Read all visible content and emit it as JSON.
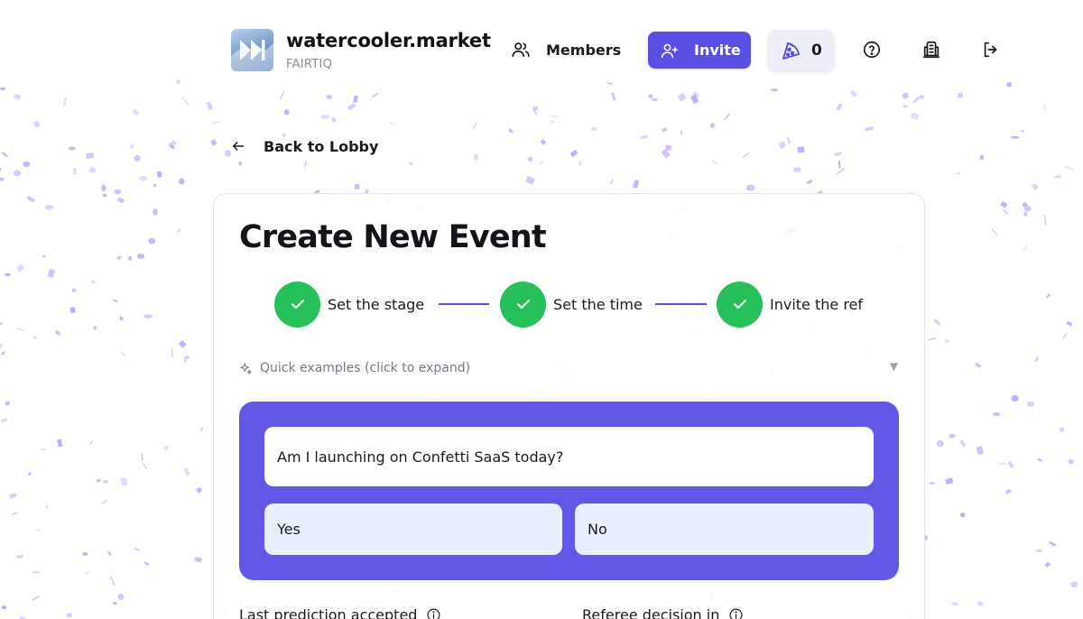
{
  "brand": {
    "name": "watercooler.market",
    "org": "FAIRTIQ",
    "logo_icon": "fast-forward-logo"
  },
  "nav": {
    "members_label": "Members",
    "invite_label": "Invite",
    "points_value": "0",
    "icons": [
      "users-icon",
      "user-plus-icon",
      "pizza-slice-icon",
      "help-circle-icon",
      "rules-book-icon",
      "logout-icon"
    ]
  },
  "back": {
    "label": "Back to Lobby"
  },
  "form": {
    "title": "Create New Event",
    "steps": [
      {
        "label": "Set the stage",
        "status": "complete"
      },
      {
        "label": "Set the time",
        "status": "complete"
      },
      {
        "label": "Invite the ref",
        "status": "complete"
      }
    ],
    "examples_label": "Quick examples (click to expand)",
    "question": "Am I launching on Confetti SaaS today?",
    "options": [
      "Yes",
      "No"
    ],
    "fields": [
      {
        "label": "Last prediction accepted"
      },
      {
        "label": "Referee decision in"
      }
    ]
  },
  "colors": {
    "accent": "#5a4fe3",
    "question_box": "#6156e6",
    "option_bg": "#e9effd",
    "step_complete": "#25c05a",
    "confetti": "#b79cf5"
  }
}
